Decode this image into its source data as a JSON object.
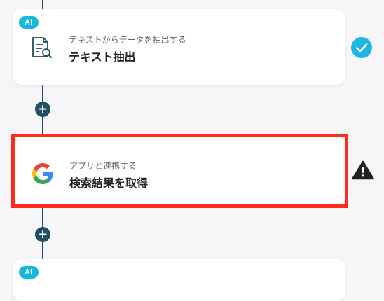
{
  "flow": {
    "steps": [
      {
        "badge": "AI",
        "subtitle": "テキストからデータを抽出する",
        "title": "テキスト抽出",
        "icon": "document-search-icon",
        "status": "completed"
      },
      {
        "subtitle": "アプリと連携する",
        "title": "検索結果を取得",
        "icon": "google-icon",
        "status": "warning",
        "highlighted": true
      },
      {
        "badge": "AI"
      }
    ],
    "add_step_label": "+"
  },
  "colors": {
    "line": "#1e4f63",
    "ai_badge": "#17b8d9",
    "check": "#1fb6e0",
    "highlight_border": "#ff2a1a",
    "warning": "#222222"
  }
}
